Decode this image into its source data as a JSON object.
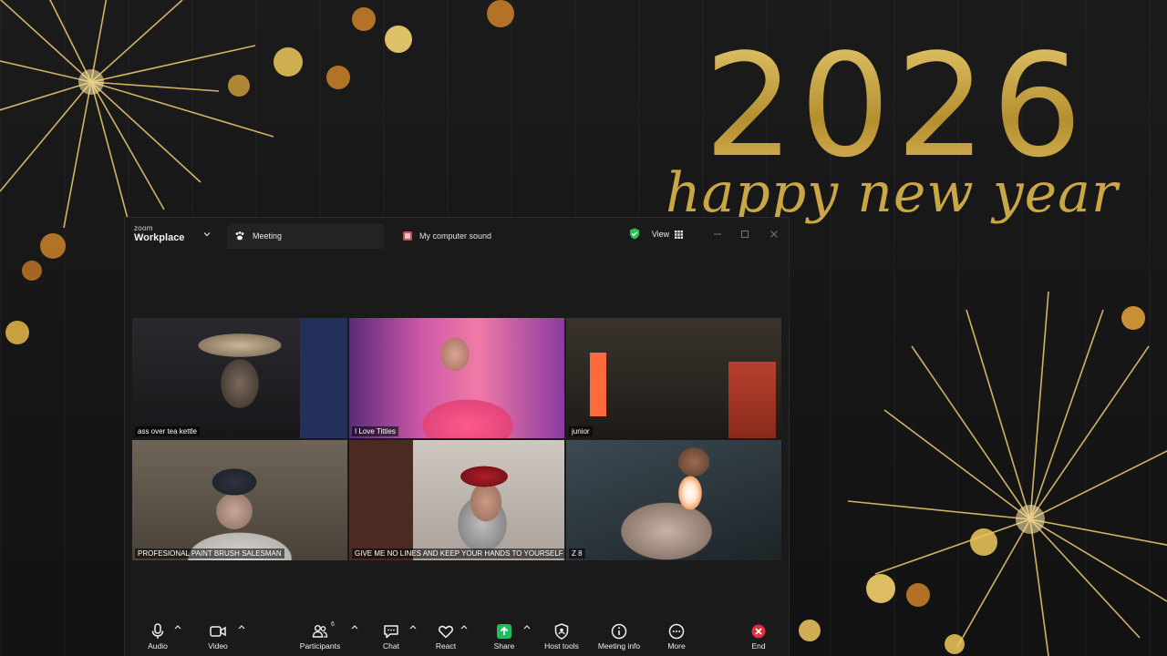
{
  "wallpaper": {
    "year": "2026",
    "greeting": "happy new year"
  },
  "titlebar": {
    "brand_top": "zoom",
    "brand_bottom": "Workplace",
    "tab_meeting": "Meeting",
    "tab_sound": "My computer sound",
    "view_label": "View"
  },
  "participants": [
    {
      "name": "ass over tea kettle"
    },
    {
      "name": "I Love Titties"
    },
    {
      "name": "junior"
    },
    {
      "name": "PROFESIONAL PAINT BRUSH SALESMAN"
    },
    {
      "name": "GIVE ME NO LINES AND KEEP YOUR HANDS TO YOURSELF",
      "active": true
    },
    {
      "name": "Z 8"
    }
  ],
  "toolbar": {
    "audio": "Audio",
    "video": "Video",
    "participants": "Participants",
    "participants_count": "6",
    "chat": "Chat",
    "react": "React",
    "share": "Share",
    "host_tools": "Host tools",
    "meeting_info": "Meeting info",
    "more": "More",
    "end": "End"
  },
  "colors": {
    "accent_green": "#5fd38f",
    "share_green": "#1fbf5f",
    "end_red": "#e0303a",
    "gold": "#c9a646"
  },
  "icons": [
    "zoom-brand",
    "chevron-down-icon",
    "paw-icon",
    "speaker-icon",
    "shield-check-icon",
    "grid-icon",
    "minimize-icon",
    "maximize-icon",
    "close-icon",
    "microphone-icon",
    "camera-icon",
    "people-icon",
    "chat-icon",
    "heart-icon",
    "share-arrow-icon",
    "shield-icon",
    "info-icon",
    "more-icon",
    "end-icon"
  ]
}
